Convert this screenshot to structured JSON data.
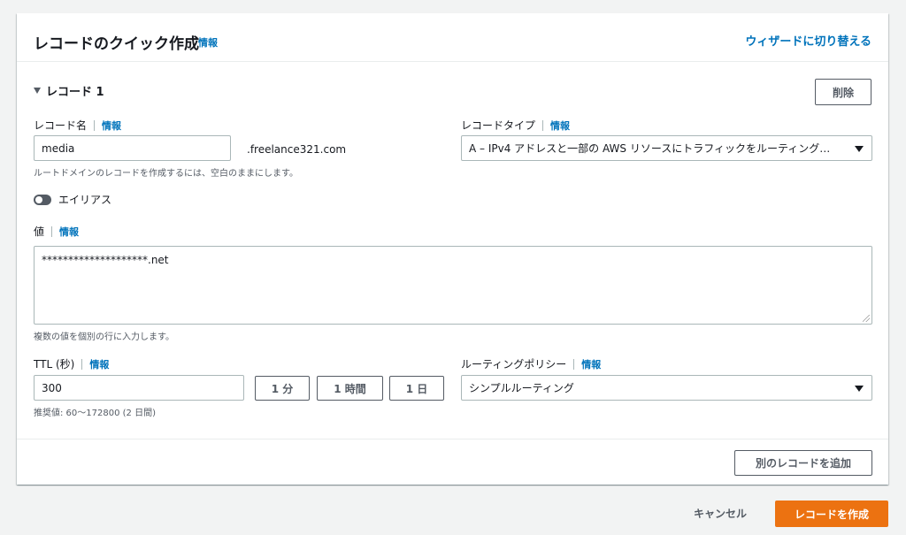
{
  "header": {
    "title": "レコードのクイック作成",
    "info": "情報",
    "wizard_link": "ウィザードに切り替える"
  },
  "record": {
    "section_label": "レコード 1",
    "delete_label": "削除",
    "name": {
      "label": "レコード名",
      "info": "情報",
      "value": "media",
      "domain_suffix": ".freelance321.com",
      "hint": "ルートドメインのレコードを作成するには、空白のままにします。"
    },
    "type": {
      "label": "レコードタイプ",
      "info": "情報",
      "value": "A – IPv4 アドレスと一部の AWS リソースにトラフィックをルーティング…"
    },
    "alias": {
      "label": "エイリアス",
      "enabled": false
    },
    "value": {
      "label": "値",
      "info": "情報",
      "content": "********************.net",
      "hint": "複数の値を個別の行に入力します。"
    },
    "ttl": {
      "label": "TTL (秒)",
      "info": "情報",
      "value": "300",
      "presets": [
        "1 分",
        "1 時間",
        "1 日"
      ],
      "hint": "推奨値: 60～172800 (2 日間)"
    },
    "routing": {
      "label": "ルーティングポリシー",
      "info": "情報",
      "value": "シンプルルーティング"
    }
  },
  "footer": {
    "add_record_label": "別のレコードを追加",
    "cancel_label": "キャンセル",
    "create_label": "レコードを作成"
  },
  "colors": {
    "accent_link": "#0073bb",
    "primary_button": "#ec7211",
    "border": "#aab7b8",
    "background": "#f2f3f3"
  }
}
